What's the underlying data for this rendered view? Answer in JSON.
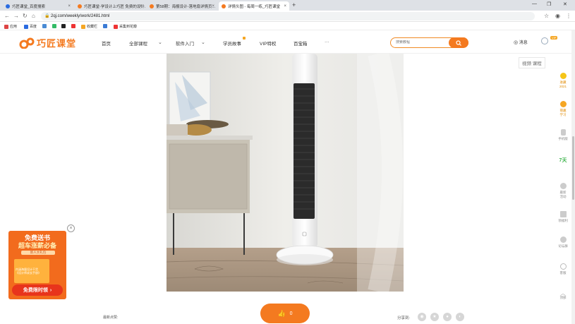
{
  "browser": {
    "tabs": [
      {
        "title": "巧匠课堂_百度搜索",
        "favicon_color": "#2a6be0",
        "active": false
      },
      {
        "title": "巧匠课堂-学设计上巧匠 免费的设计...",
        "favicon_color": "#f47a20",
        "active": false
      },
      {
        "title": "第58期：海报设计-落地扇详情页...",
        "favicon_color": "#f47a20",
        "active": false
      },
      {
        "title": "详情头图 - 每周一练_巧匠课堂",
        "favicon_color": "#f47a20",
        "active": true
      }
    ],
    "new_tab": "+",
    "url": "2qj.com/weekly/work/2481.html",
    "bookmarks": [
      {
        "label": "应用",
        "color": "#d44"
      },
      {
        "label": "百度",
        "color": "#2a6be0"
      },
      {
        "label": "",
        "color": "#4a8bd4"
      },
      {
        "label": "",
        "color": "#3b6"
      },
      {
        "label": "",
        "color": "#222"
      },
      {
        "label": "收藏栏",
        "color": "#f5a623"
      },
      {
        "label": "",
        "color": "#3a7bd5"
      },
      {
        "label": "采集到花瓣",
        "color": "#e33"
      }
    ]
  },
  "site": {
    "logo_text": "巧匠课堂",
    "brand_color": "#f47a20",
    "nav": [
      "首页",
      "全部课程",
      "软件入门",
      "学员故事",
      "VIP特权",
      "百宝箱",
      "···"
    ],
    "search_placeholder": "搜索教程",
    "messages": "消息",
    "vip": "VIP"
  },
  "main": {
    "video_badge": "视频 课程",
    "like_count": "0",
    "footer_left": "最新点赞:",
    "share_label": "分享到:"
  },
  "sidebar": [
    {
      "label": "进藏\n2021",
      "color": "#f5a623"
    },
    {
      "label": "萌趣\n学习",
      "color": "#f5a623"
    },
    {
      "label": "手机版",
      "color": "#bbb"
    },
    {
      "label": "7天",
      "color": "#3bb34a"
    },
    {
      "label": "最新\n活动",
      "color": "#bbb"
    },
    {
      "label": "领福利",
      "color": "#bbb"
    },
    {
      "label": "论坛群",
      "color": "#bbb"
    },
    {
      "label": "客服",
      "color": "#bbb"
    },
    {
      "label": "顶部",
      "color": "#bbb"
    }
  ],
  "promo": {
    "title_line1": "免费送书",
    "title_line2": "超车涨薪必备",
    "subtitle": "新人大礼包",
    "book_text": "内涵海量设计干货\n《设计师成长手册》",
    "button": "免费限时领"
  }
}
